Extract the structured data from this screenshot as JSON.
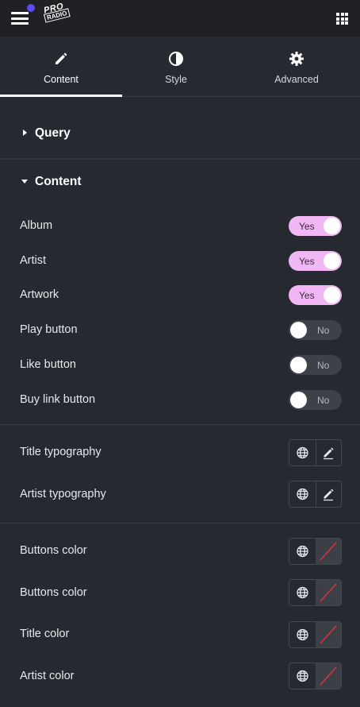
{
  "header": {
    "logo_text_pro": "PRO",
    "logo_text_radio": "RADIO",
    "notification_color": "#5b4cf6"
  },
  "tabs": [
    {
      "label": "Content",
      "icon": "pencil-icon",
      "active": true
    },
    {
      "label": "Style",
      "icon": "half-circle-icon",
      "active": false
    },
    {
      "label": "Advanced",
      "icon": "gear-icon",
      "active": false
    }
  ],
  "sections": {
    "query": {
      "title": "Query",
      "expanded": false
    },
    "content": {
      "title": "Content",
      "expanded": true
    }
  },
  "toggles": [
    {
      "label": "Album",
      "value": "Yes",
      "on": true
    },
    {
      "label": "Artist",
      "value": "Yes",
      "on": true
    },
    {
      "label": "Artwork",
      "value": "Yes",
      "on": true
    },
    {
      "label": "Play button",
      "value": "No",
      "on": false
    },
    {
      "label": "Like button",
      "value": "No",
      "on": false
    },
    {
      "label": "Buy link button",
      "value": "No",
      "on": false
    }
  ],
  "typography": [
    {
      "label": "Title typography",
      "icons": [
        "globe-icon",
        "edit-pencil-icon"
      ]
    },
    {
      "label": "Artist typography",
      "icons": [
        "globe-icon",
        "edit-pencil-icon"
      ]
    }
  ],
  "colors": [
    {
      "label": "Buttons color",
      "icons": [
        "globe-icon",
        "no-color-swatch-icon"
      ]
    },
    {
      "label": "Buttons color",
      "icons": [
        "globe-icon",
        "no-color-swatch-icon"
      ]
    },
    {
      "label": "Title color",
      "icons": [
        "globe-icon",
        "no-color-swatch-icon"
      ]
    },
    {
      "label": "Artist color",
      "icons": [
        "globe-icon",
        "no-color-swatch-icon"
      ]
    }
  ],
  "theme": {
    "toggle_on_color": "#f0b7f4",
    "toggle_off_color": "#3e4148",
    "background": "#26292f",
    "topbar": "#1f2124"
  }
}
